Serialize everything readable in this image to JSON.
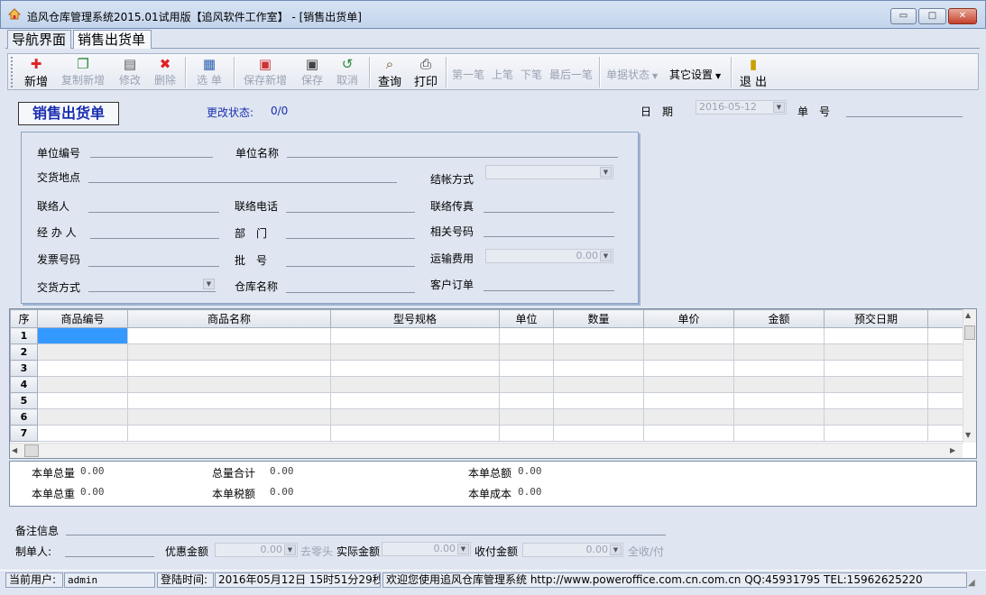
{
  "window": {
    "title": "追风仓库管理系统2015.01试用版【追风软件工作室】 - [销售出货单]",
    "min_label": "▭",
    "max_label": "□",
    "close_label": "✕"
  },
  "tabs": [
    {
      "label": "导航界面"
    },
    {
      "label": "销售出货单"
    }
  ],
  "toolbar": {
    "new": "新增",
    "copy_new": "复制新增",
    "edit": "修改",
    "delete": "删除",
    "select": "选 单",
    "save_new": "保存新增",
    "save": "保存",
    "cancel": "取消",
    "query": "查询",
    "print": "打印",
    "first": "第一笔",
    "prev": "上笔",
    "next": "下笔",
    "last": "最后一笔",
    "doc_status": "单据状态",
    "other_settings": "其它设置",
    "exit": "退 出"
  },
  "header": {
    "doc_title": "销售出货单",
    "change_status_label": "更改状态:",
    "change_status_value": "0/0",
    "date_label": "日　期",
    "date_value": "2016-05-12",
    "number_label": "单　号"
  },
  "form": {
    "unit_code": "单位编号",
    "unit_name": "单位名称",
    "delivery_place": "交货地点",
    "settlement": "结帐方式",
    "contact": "联络人",
    "contact_phone": "联络电话",
    "contact_fax": "联络传真",
    "handler": "经 办 人",
    "department": "部　门",
    "related_no": "相关号码",
    "invoice_no": "发票号码",
    "batch_no": "批　号",
    "freight": "运输费用",
    "freight_value": "0.00",
    "delivery_mode": "交货方式",
    "warehouse": "仓库名称",
    "customer_order": "客户订单"
  },
  "grid": {
    "columns": [
      "序",
      "商品编号",
      "商品名称",
      "型号规格",
      "单位",
      "数量",
      "单价",
      "金额",
      "预交日期"
    ],
    "rows": [
      "1",
      "2",
      "3",
      "4",
      "5",
      "6",
      "7"
    ]
  },
  "totals": {
    "total_qty_label": "本单总量",
    "total_qty": "0.00",
    "total_sum_label": "总量合计",
    "total_sum": "0.00",
    "total_amount_label": "本单总额",
    "total_amount": "0.00",
    "total_weight_label": "本单总重",
    "total_weight": "0.00",
    "total_tax_label": "本单税额",
    "total_tax": "0.00",
    "total_cost_label": "本单成本",
    "total_cost": "0.00"
  },
  "footer": {
    "remarks": "备注信息",
    "creator": "制单人:",
    "discount": "优惠金额",
    "discount_value": "0.00",
    "round_off": "去零头",
    "actual_amount": "实际金额",
    "actual_value": "0.00",
    "received": "收付金额",
    "received_value": "0.00",
    "full_pay": "全收/付"
  },
  "status": {
    "user_label": "当前用户:",
    "user": "admin",
    "login_label": "登陆时间:",
    "login_time": "2016年05月12日 15时51分29秒",
    "welcome": "欢迎您使用追风仓库管理系统 http://www.poweroffice.com.cn.com.cn QQ:45931795 TEL:15962625220"
  },
  "colors": {
    "accent": "#3399ff",
    "title_blue": "#1a2fb0",
    "background": "#dfe6f1"
  }
}
